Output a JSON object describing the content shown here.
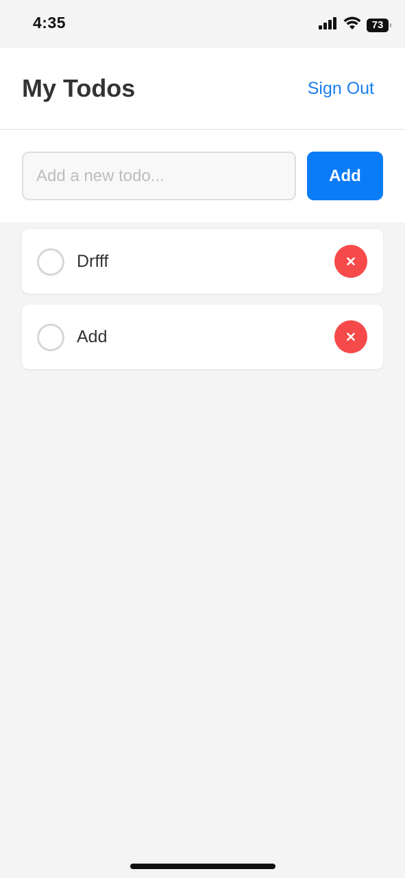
{
  "status_bar": {
    "time": "4:35",
    "battery": "73"
  },
  "header": {
    "title": "My Todos",
    "sign_out_label": "Sign Out"
  },
  "new_todo": {
    "value": "",
    "placeholder": "Add a new todo...",
    "add_label": "Add"
  },
  "todos": [
    {
      "text": "Drfff",
      "completed": false
    },
    {
      "text": "Add",
      "completed": false
    }
  ],
  "colors": {
    "accent": "#0a7cf7",
    "link": "#1a7ff0",
    "delete": "#f64a4a",
    "background": "#f4f4f4"
  }
}
